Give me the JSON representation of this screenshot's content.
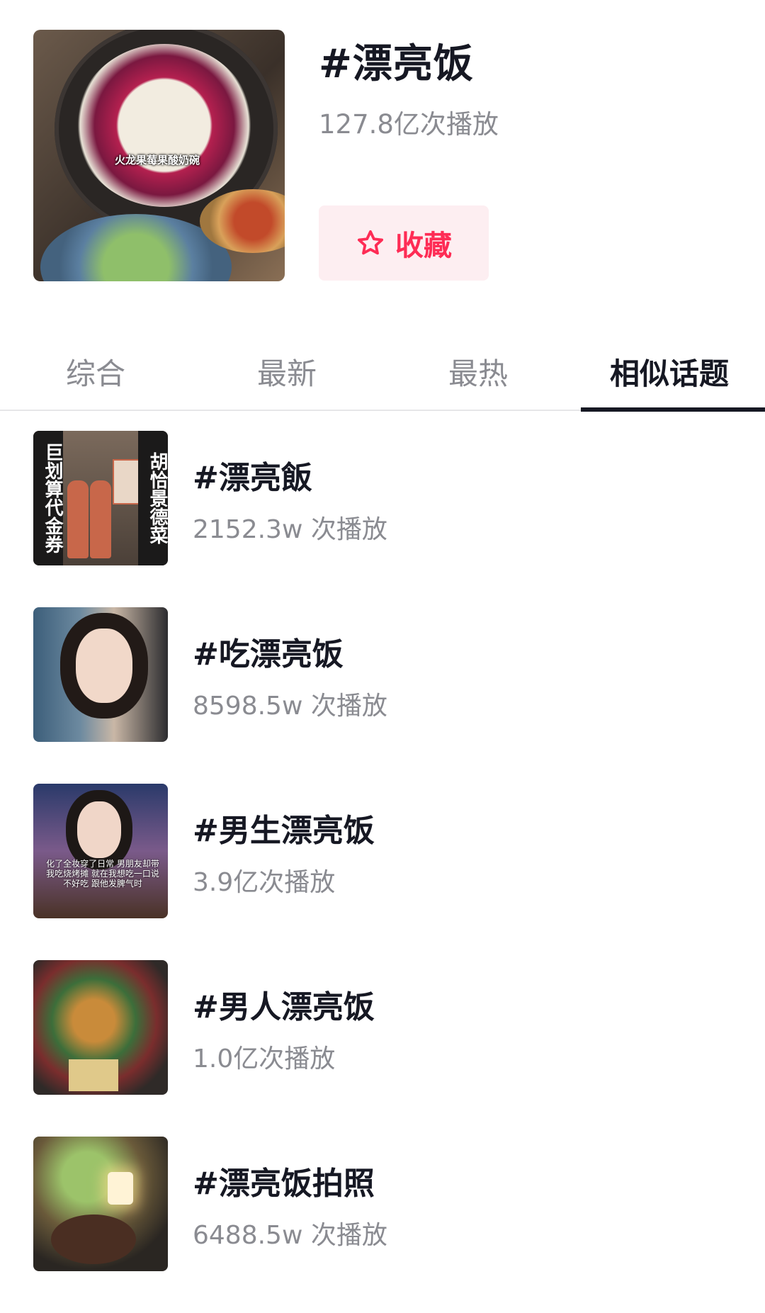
{
  "topic": {
    "title": "#漂亮饭",
    "plays": "127.8亿次播放",
    "cover_caption": "火龙果莓果酸奶碗",
    "favorite_label": "收藏"
  },
  "tabs": [
    {
      "label": "综合",
      "active": false
    },
    {
      "label": "最新",
      "active": false
    },
    {
      "label": "最热",
      "active": false
    },
    {
      "label": "相似话题",
      "active": true
    }
  ],
  "related": [
    {
      "title": "#漂亮飯",
      "plays": "2152.3w 次播放",
      "thumb_left": "巨划算代金券",
      "thumb_right": "胡恰景德菜"
    },
    {
      "title": "#吃漂亮饭",
      "plays": "8598.5w 次播放"
    },
    {
      "title": "#男生漂亮饭",
      "plays": "3.9亿次播放",
      "thumb_caption": "化了全妆穿了日常 男朋友却带我吃烧烤摊 就在我想吃一口说不好吃 跟他发脾气时"
    },
    {
      "title": "#男人漂亮饭",
      "plays": "1.0亿次播放"
    },
    {
      "title": "#漂亮饭拍照",
      "plays": "6488.5w 次播放"
    }
  ],
  "colors": {
    "accent": "#fe2c55",
    "fav_bg": "#fdeef1",
    "text": "#161823",
    "muted": "#8a8b91"
  }
}
